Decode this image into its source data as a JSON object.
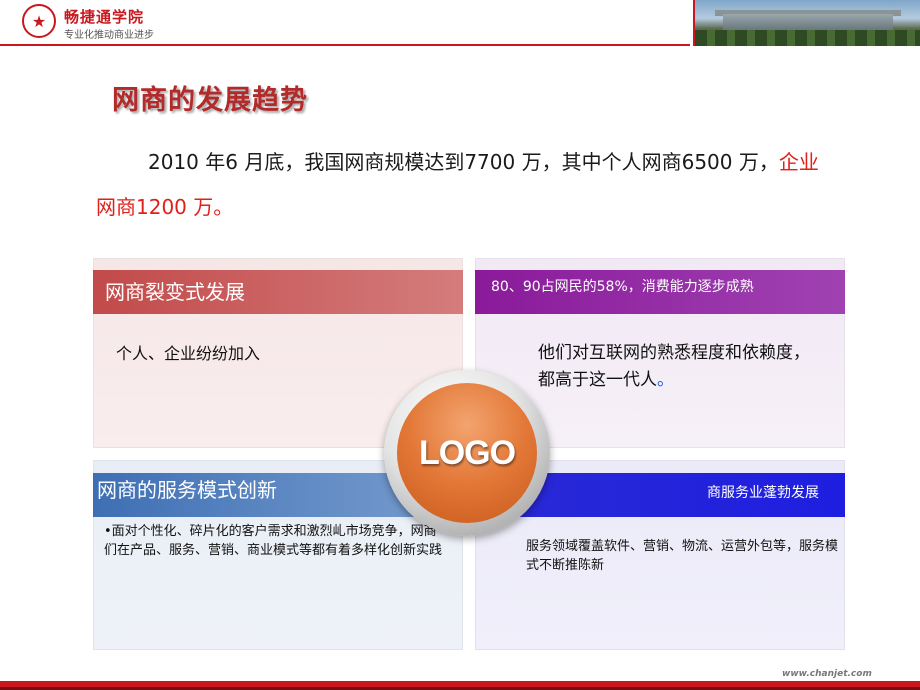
{
  "header": {
    "brand_name": "畅捷通学院",
    "slogan": "专业化推动商业进步",
    "emblem_icon": "star-emblem-icon",
    "brand_color": "#c8171e"
  },
  "title": "网商的发展趋势",
  "intro": {
    "text_plain": "2010 年6 月底，我国网商规模达到7700 万，其中个人网商6500 万，",
    "text_red": "企业网商1200 万。"
  },
  "quadrants": [
    {
      "heading": "网商裂变式发展",
      "body": "个人、企业纷纷加入",
      "color": "#c24a4a"
    },
    {
      "heading": "80、90占网民的58%，消费能力逐步成熟",
      "body": "他们对互联网的熟悉程度和依赖度，都高于这一代人",
      "body_suffix": "。",
      "color": "#8a1a9a"
    },
    {
      "heading": "网商的服务模式创新",
      "body": "•面对个性化、碎片化的客户需求和激烈乢市场竞争，网商们在产品、服务、营销、商业模式等都有着多样化创新实践",
      "color": "#3e6fb4"
    },
    {
      "heading": "商服务业蓬勃发展",
      "body": "服务领域覆盖软件、营销、物流、运营外包等，服务模式不断推陈新",
      "color": "#2a2ad6"
    }
  ],
  "logo_text": "LOGO",
  "footer": {
    "url": "www.chanjet.com"
  }
}
